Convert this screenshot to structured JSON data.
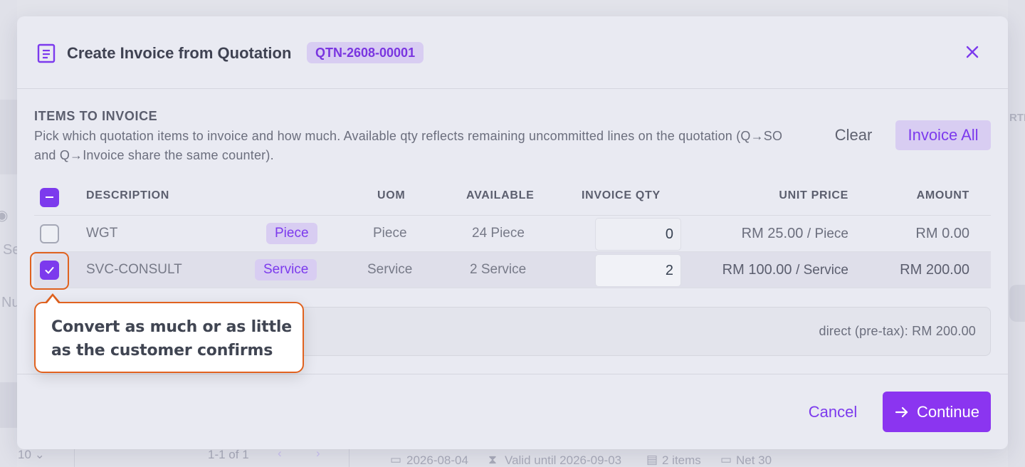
{
  "colors": {
    "accent": "#7c3aed",
    "highlight": "#e0621f",
    "pill_bg": "#d8cdf2"
  },
  "background": {
    "partial_texts": [
      "Se",
      "Nu",
      "RTE"
    ],
    "pagination": {
      "page_size": "10",
      "range": "1-1 of 1"
    },
    "meta": {
      "date": "2026-08-04",
      "valid_until": "Valid until 2026-09-03",
      "items": "2 items",
      "terms": "Net 30"
    }
  },
  "modal": {
    "title": "Create Invoice from Quotation",
    "quotation_ref": "QTN-2608-00001",
    "close_icon": "close-icon",
    "section_title": "ITEMS TO INVOICE",
    "section_description": "Pick which quotation items to invoice and how much. Available qty reflects remaining uncommitted lines on the quotation (Q→SO and Q→Invoice share the same counter).",
    "clear_label": "Clear",
    "invoice_all_label": "Invoice All",
    "columns": {
      "description": "DESCRIPTION",
      "uom": "UOM",
      "available": "AVAILABLE",
      "invoice_qty": "INVOICE QTY",
      "unit_price": "UNIT PRICE",
      "amount": "AMOUNT"
    },
    "rows": [
      {
        "code": "WGT",
        "tag": "Piece",
        "uom": "Piece",
        "available": "24 Piece",
        "qty": "0",
        "price": "RM 25.00",
        "price_uom": "/ Piece",
        "amount": "RM 0.00",
        "selected": false
      },
      {
        "code": "SVC-CONSULT",
        "tag": "Service",
        "uom": "Service",
        "available": "2 Service",
        "qty": "2",
        "price": "RM 100.00",
        "price_uom": "/ Service",
        "amount": "RM 200.00",
        "selected": true
      }
    ],
    "summary": "direct (pre-tax): RM 200.00",
    "cancel_label": "Cancel",
    "continue_label": "Continue"
  },
  "tooltip": {
    "text": "Convert as much or as little as the customer confirms"
  }
}
